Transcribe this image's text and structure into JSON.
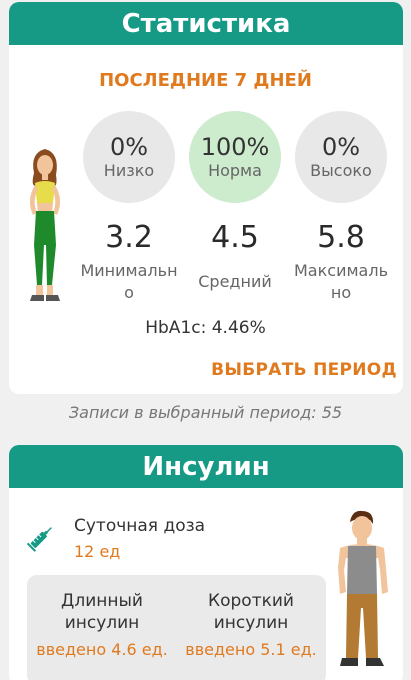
{
  "statistics": {
    "title": "Статистика",
    "period_title": "ПОСЛЕДНИЕ 7 ДНЕЙ",
    "low": {
      "percent": "0%",
      "label": "Низко"
    },
    "normal": {
      "percent": "100%",
      "label": "Норма"
    },
    "high": {
      "percent": "0%",
      "label": "Высоко"
    },
    "min": {
      "value": "3.2",
      "label": "Минимально"
    },
    "avg": {
      "value": "4.5",
      "label": "Средний"
    },
    "max": {
      "value": "5.8",
      "label": "Максимально"
    },
    "hba1c": "HbA1c: 4.46%",
    "choose_period": "ВЫБРАТЬ ПЕРИОД"
  },
  "records": "Записи в выбранный период: 55",
  "insulin": {
    "title": "Инсулин",
    "daily_label": "Суточная доза",
    "daily_value": "12 ед",
    "long": {
      "name": "Длинный инсулин",
      "done": "введено 4.6 ед."
    },
    "short": {
      "name": "Короткий инсулин",
      "done": "введено 5.1 ед."
    }
  },
  "colors": {
    "header": "#169a86",
    "accent": "#e07a1f",
    "normal_circle": "#cdeccd",
    "neutral_circle": "#e8e8e8"
  },
  "icons": {
    "syringe": "syringe-icon",
    "woman": "woman-illustration",
    "man": "man-illustration"
  }
}
